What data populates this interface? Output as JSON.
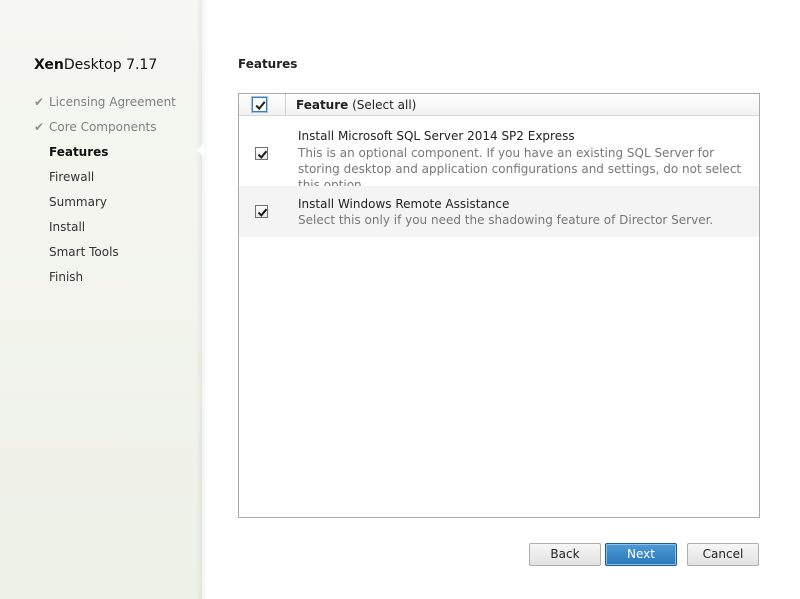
{
  "product": {
    "brand": "Xen",
    "name": "Desktop 7.17"
  },
  "steps": [
    {
      "label": "Licensing Agreement",
      "state": "done"
    },
    {
      "label": "Core Components",
      "state": "done"
    },
    {
      "label": "Features",
      "state": "active"
    },
    {
      "label": "Firewall",
      "state": "pending"
    },
    {
      "label": "Summary",
      "state": "pending"
    },
    {
      "label": "Install",
      "state": "pending"
    },
    {
      "label": "Smart Tools",
      "state": "pending"
    },
    {
      "label": "Finish",
      "state": "pending"
    }
  ],
  "check_glyph": "✔",
  "page": {
    "title": "Features"
  },
  "table": {
    "header": {
      "column": "Feature",
      "select_all": "(Select all)",
      "checked": true
    },
    "rows": [
      {
        "title": "Install Microsoft SQL Server 2014 SP2 Express",
        "description": "This is an optional component. If you have an existing SQL Server for storing desktop and application configurations and settings, do not select this option.",
        "checked": true
      },
      {
        "title": "Install Windows Remote Assistance",
        "description": "Select this only if you need the shadowing feature of Director Server.",
        "checked": true
      }
    ]
  },
  "buttons": {
    "back": "Back",
    "next": "Next",
    "cancel": "Cancel"
  },
  "colors": {
    "accent": "#2a78b8",
    "sidebar_bg": "#f2f4ee",
    "done_text": "#808080"
  }
}
